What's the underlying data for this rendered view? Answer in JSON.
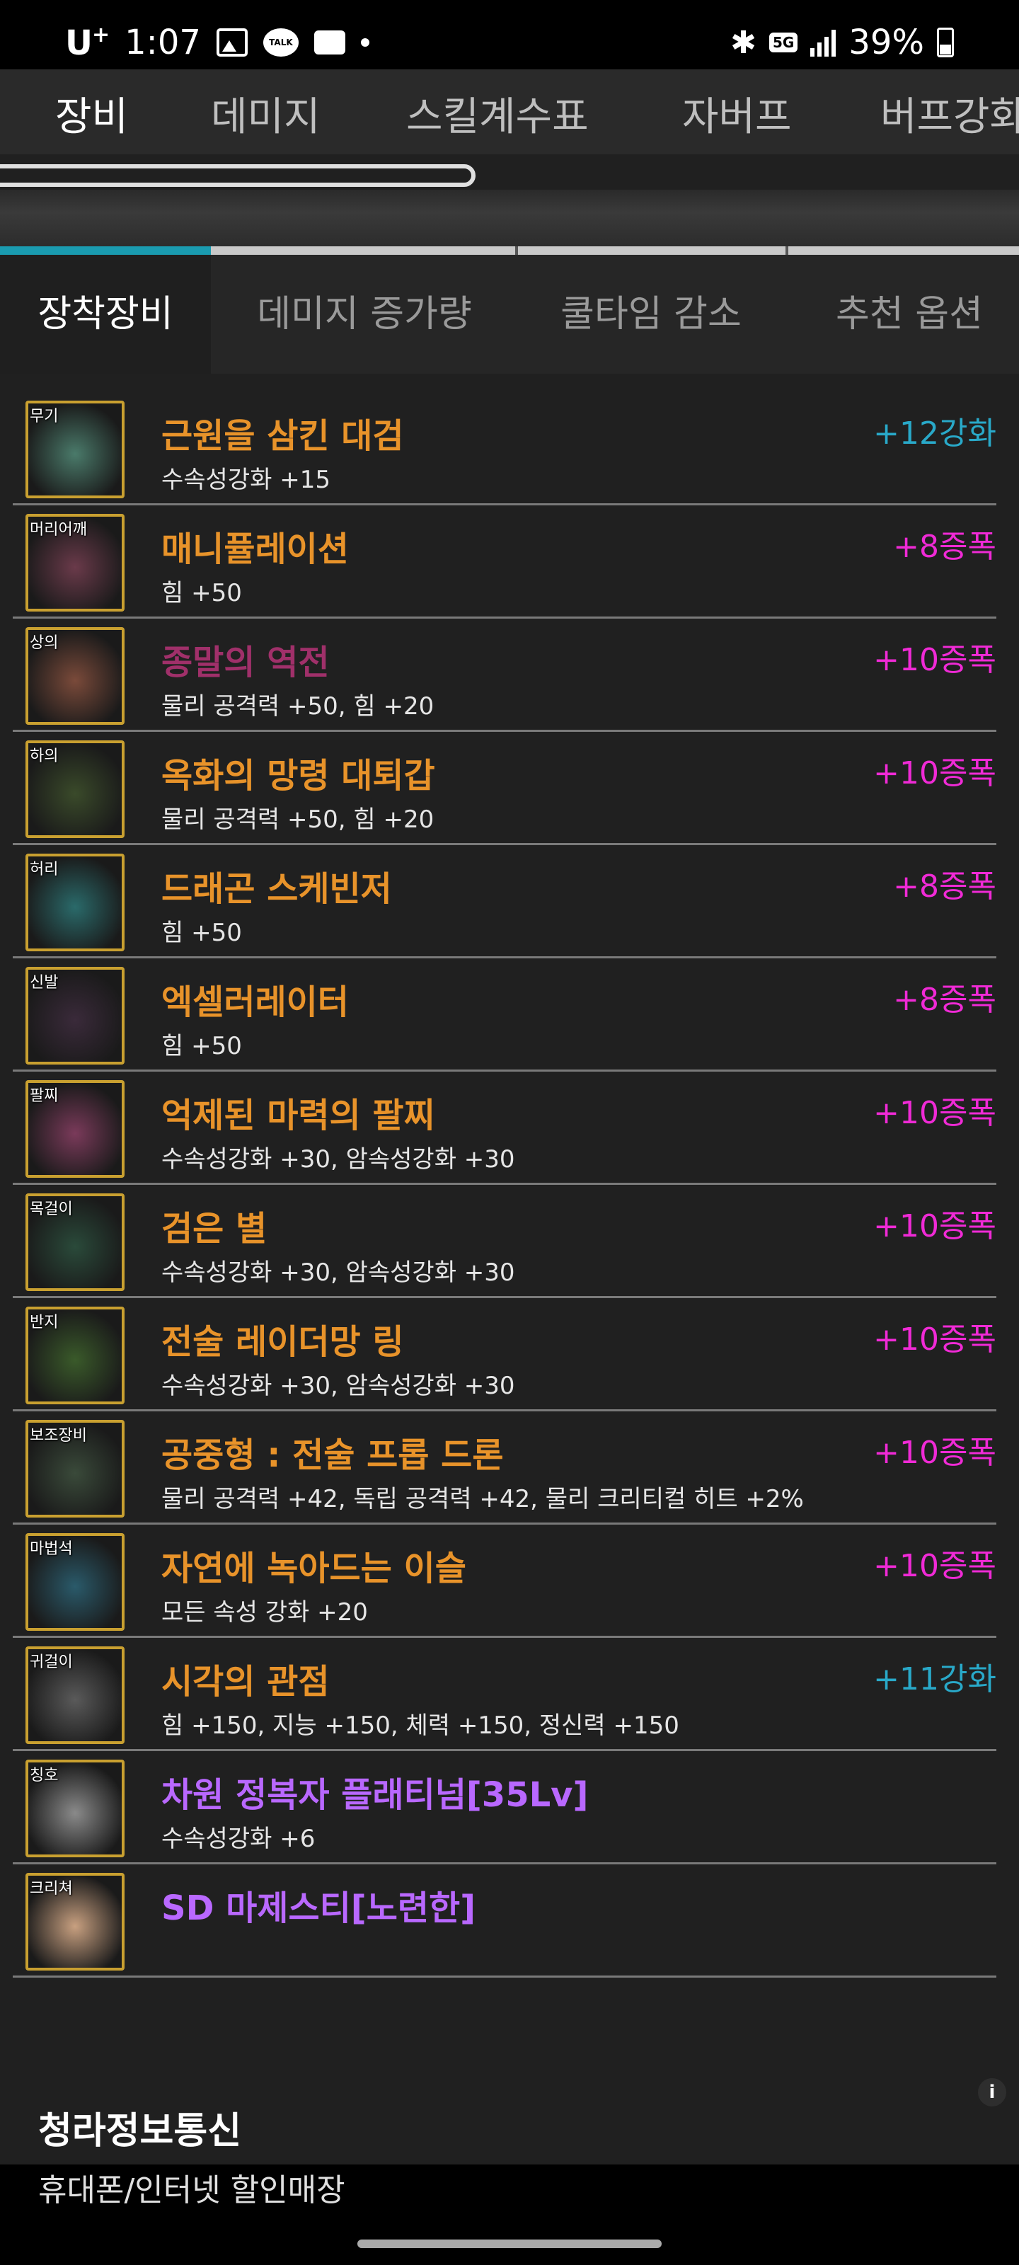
{
  "status_bar": {
    "carrier": "U",
    "carrier_plus": "+",
    "time": "1:07",
    "talk_label": "TALK",
    "fiveg": "5G",
    "battery": "39%"
  },
  "top_tabs": [
    "장비",
    "데미지",
    "스킬계수표",
    "자버프",
    "버프강화"
  ],
  "sub_tabs": [
    "장착장비",
    "데미지 증가량",
    "쿨타임 감소",
    "추천 옵션"
  ],
  "equipment": [
    {
      "slot": "무기",
      "name": "근원을 삼킨 대검",
      "desc": "수속성강화 +15",
      "upgrade": "+12강화",
      "upgrade_color": "cyan",
      "rarity": "unique",
      "thumb": "#4a7a6a"
    },
    {
      "slot": "머리어깨",
      "name": "매니퓰레이션",
      "desc": "힘 +50",
      "upgrade": "+8증폭",
      "upgrade_color": "pink",
      "rarity": "unique",
      "thumb": "#6a3a4a"
    },
    {
      "slot": "상의",
      "name": "종말의 역전",
      "desc": "물리 공격력 +50, 힘 +20",
      "upgrade": "+10증폭",
      "upgrade_color": "pink",
      "rarity": "legend",
      "thumb": "#7a4a3a"
    },
    {
      "slot": "하의",
      "name": "옥화의 망령 대퇴갑",
      "desc": "물리 공격력 +50, 힘 +20",
      "upgrade": "+10증폭",
      "upgrade_color": "pink",
      "rarity": "unique",
      "thumb": "#3a4a2a"
    },
    {
      "slot": "허리",
      "name": "드래곤 스케빈저",
      "desc": "힘 +50",
      "upgrade": "+8증폭",
      "upgrade_color": "pink",
      "rarity": "unique",
      "thumb": "#2a6a6a"
    },
    {
      "slot": "신발",
      "name": "엑셀러레이터",
      "desc": "힘 +50",
      "upgrade": "+8증폭",
      "upgrade_color": "pink",
      "rarity": "unique",
      "thumb": "#3a2a3a"
    },
    {
      "slot": "팔찌",
      "name": "억제된 마력의 팔찌",
      "desc": "수속성강화 +30, 암속성강화 +30",
      "upgrade": "+10증폭",
      "upgrade_color": "pink",
      "rarity": "unique",
      "thumb": "#7a3a5a"
    },
    {
      "slot": "목걸이",
      "name": "검은 별",
      "desc": "수속성강화 +30, 암속성강화 +30",
      "upgrade": "+10증폭",
      "upgrade_color": "pink",
      "rarity": "unique",
      "thumb": "#2a4a3a"
    },
    {
      "slot": "반지",
      "name": "전술 레이더망 링",
      "desc": "수속성강화 +30, 암속성강화 +30",
      "upgrade": "+10증폭",
      "upgrade_color": "pink",
      "rarity": "unique",
      "thumb": "#3a5a2a"
    },
    {
      "slot": "보조장비",
      "name": "공중형 : 전술 프롭 드론",
      "desc": "물리 공격력 +42, 독립 공격력 +42, 물리 크리티컬 히트 +2%",
      "upgrade": "+10증폭",
      "upgrade_color": "pink",
      "rarity": "unique",
      "thumb": "#3a4a3a"
    },
    {
      "slot": "마법석",
      "name": "자연에 녹아드는 이슬",
      "desc": "모든 속성 강화 +20",
      "upgrade": "+10증폭",
      "upgrade_color": "pink",
      "rarity": "unique",
      "thumb": "#2a5a6a"
    },
    {
      "slot": "귀걸이",
      "name": "시각의 관점",
      "desc": "힘 +150, 지능 +150, 체력 +150, 정신력 +150",
      "upgrade": "+11강화",
      "upgrade_color": "cyan",
      "rarity": "unique",
      "thumb": "#5a5a5a"
    },
    {
      "slot": "칭호",
      "name": "차원 정복자 플래티넘[35Lv]",
      "desc": "수속성강화 +6",
      "upgrade": "",
      "upgrade_color": "",
      "rarity": "epic",
      "thumb": "#8a8a8a"
    },
    {
      "slot": "크리쳐",
      "name": "SD 마제스티[노련한]",
      "desc": "",
      "upgrade": "",
      "upgrade_color": "",
      "rarity": "epic",
      "thumb": "#c8a080"
    }
  ],
  "ad": {
    "info_icon": "i",
    "title": "청라정보통신",
    "subtitle": "휴대폰/인터넷 할인매장"
  },
  "colors": {
    "accent": "#1a9bb0",
    "unique": "#e8932a",
    "epic": "#b968ff",
    "amplify": "#f02ad6",
    "reinforce": "#29a9c9"
  }
}
